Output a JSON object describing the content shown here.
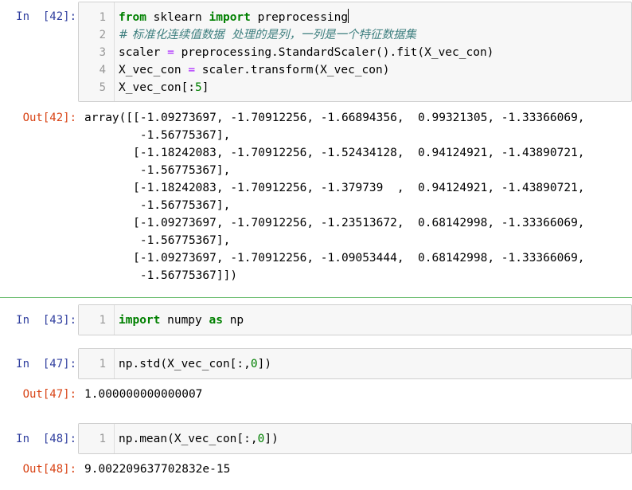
{
  "cells": [
    {
      "in_prompt": "In  [42]:",
      "out_prompt": "Out[42]:",
      "line_numbers": [
        "1",
        "2",
        "3",
        "4",
        "5"
      ],
      "code": {
        "l1_kw1": "from",
        "l1_t1": " sklearn ",
        "l1_kw2": "import",
        "l1_t2": " preprocessing",
        "l2_comment": "# 标准化连续值数据  处理的是列，一列是一个特征数据集",
        "l3_a": "scaler ",
        "l3_op": "=",
        "l3_b": " preprocessing.StandardScaler().fit(X_vec_con)",
        "l4_a": "X_vec_con ",
        "l4_op": "=",
        "l4_b": " scaler.transform(X_vec_con)",
        "l5_a": "X_vec_con[:",
        "l5_num": "5",
        "l5_b": "]"
      },
      "output_lines": [
        "array([[-1.09273697, -1.70912256, -1.66894356,  0.99321305, -1.33366069,",
        "        -1.56775367],",
        "       [-1.18242083, -1.70912256, -1.52434128,  0.94124921, -1.43890721,",
        "        -1.56775367],",
        "       [-1.18242083, -1.70912256, -1.379739  ,  0.94124921, -1.43890721,",
        "        -1.56775367],",
        "       [-1.09273697, -1.70912256, -1.23513672,  0.68142998, -1.33366069,",
        "        -1.56775367],",
        "       [-1.09273697, -1.70912256, -1.09053444,  0.68142998, -1.33366069,",
        "        -1.56775367]])"
      ]
    },
    {
      "in_prompt": "In  [43]:",
      "line_numbers": [
        "1"
      ],
      "code": {
        "kw1": "import",
        "t1": " numpy ",
        "kw2": "as",
        "t2": " np"
      }
    },
    {
      "in_prompt": "In  [47]:",
      "out_prompt": "Out[47]:",
      "line_numbers": [
        "1"
      ],
      "code": {
        "a": "np.std(X_vec_con[:,",
        "num": "0",
        "b": "])"
      },
      "output": "1.000000000000007"
    },
    {
      "in_prompt": "In  [48]:",
      "out_prompt": "Out[48]:",
      "line_numbers": [
        "1"
      ],
      "code": {
        "a": "np.mean(X_vec_con[:,",
        "num": "0",
        "b": "])"
      },
      "output": "9.002209637702832e-15"
    }
  ],
  "colors": {
    "in_prompt": "#303f9f",
    "out_prompt": "#d84315",
    "keyword": "#008000",
    "comment": "#408080",
    "operator": "#aa22ff",
    "divider": "#66bb6a"
  }
}
